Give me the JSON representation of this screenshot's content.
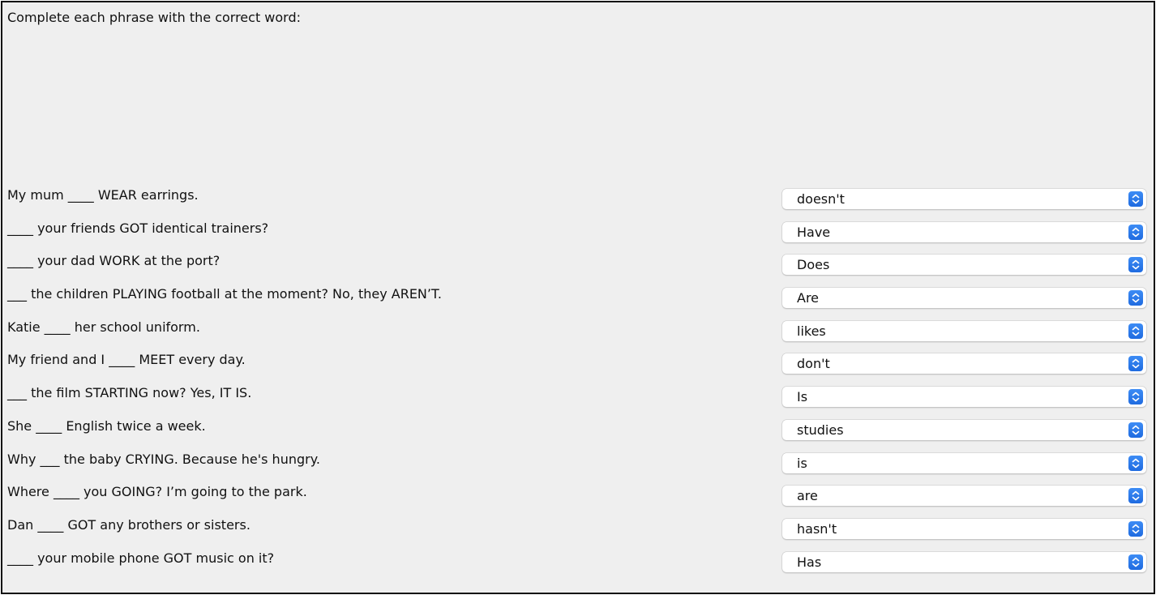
{
  "instruction": "Complete each phrase with the correct word:",
  "questions": [
    {
      "phrase": "My mum ____ WEAR earrings.",
      "selected": "doesn't"
    },
    {
      "phrase": "____ your friends GOT identical trainers?",
      "selected": "Have"
    },
    {
      "phrase": "____ your dad WORK at the port?",
      "selected": "Does"
    },
    {
      "phrase": "___ the children PLAYING football at the moment? No, they AREN’T.",
      "selected": "Are"
    },
    {
      "phrase": "Katie ____ her school uniform.",
      "selected": "likes"
    },
    {
      "phrase": "My friend and I ____ MEET every day.",
      "selected": "don't"
    },
    {
      "phrase": "___ the film STARTING now? Yes, IT IS.",
      "selected": "Is"
    },
    {
      "phrase": "She ____ English twice a week.",
      "selected": "studies"
    },
    {
      "phrase": "Why ___ the baby CRYING. Because he's hungry.",
      "selected": "is"
    },
    {
      "phrase": "Where ____ you GOING? I’m going to the park.",
      "selected": "are"
    },
    {
      "phrase": "Dan ____ GOT any brothers or sisters.",
      "selected": "hasn't"
    },
    {
      "phrase": "____ your mobile phone GOT music on it?",
      "selected": "Has"
    }
  ],
  "icons": {
    "dropdown": "chevron-up-down-icon"
  },
  "colors": {
    "panel_background": "#efefef",
    "accent": "#2a7af0",
    "border": "#111111"
  }
}
